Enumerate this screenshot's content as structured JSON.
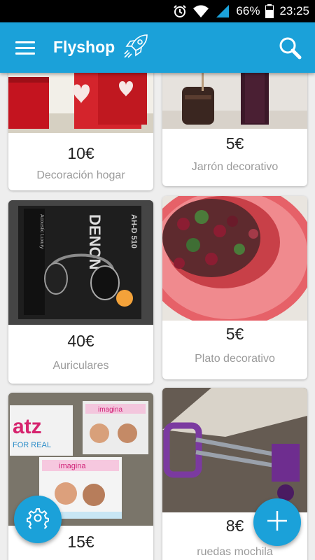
{
  "status_bar": {
    "battery": "66%",
    "time": "23:25"
  },
  "app_bar": {
    "title": "Flyshop"
  },
  "products": [
    {
      "price": "10€",
      "title": "Decoración hogar"
    },
    {
      "price": "5€",
      "title": "Jarrón decorativo"
    },
    {
      "price": "40€",
      "title": "Auriculares"
    },
    {
      "price": "5€",
      "title": "Plato decorativo"
    },
    {
      "price": "15€",
      "title": ""
    },
    {
      "price": "8€",
      "title": "ruedas mochila"
    }
  ],
  "colors": {
    "primary": "#1ba1d9",
    "status_bar": "#000000",
    "background": "#eeeeee",
    "price_text": "#222222",
    "title_text": "#9a9a9a"
  },
  "icons": {
    "menu": "hamburger-menu-icon",
    "logo": "rocket-icon",
    "search": "search-icon",
    "settings": "gear-icon",
    "add": "plus-icon"
  }
}
